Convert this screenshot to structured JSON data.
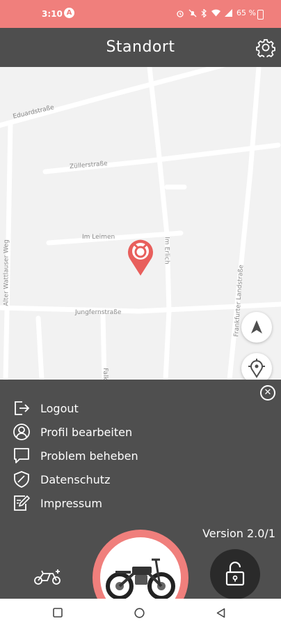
{
  "status_bar": {
    "time": "3:10",
    "a_icon": "A",
    "battery": "65 %"
  },
  "header": {
    "title": "Standort"
  },
  "map": {
    "streets": [
      "Eduardstraße",
      "Züllerstraße",
      "Im Leimen",
      "Im Erlich",
      "Jungfernstraße",
      "Alter Wattlauser Weg",
      "Frankfurter Landstraße",
      "Falk"
    ]
  },
  "menu": {
    "items": [
      {
        "label": "Logout",
        "icon": "logout-icon"
      },
      {
        "label": "Profil bearbeiten",
        "icon": "user-icon"
      },
      {
        "label": "Problem beheben",
        "icon": "chat-icon"
      },
      {
        "label": "Datenschutz",
        "icon": "shield-icon"
      },
      {
        "label": "Impressum",
        "icon": "edit-icon"
      }
    ],
    "version": "Version 2.0/1"
  },
  "colors": {
    "accent": "#f07f7c",
    "header": "#4e4e4e",
    "sheet": "#4f4f4f"
  }
}
